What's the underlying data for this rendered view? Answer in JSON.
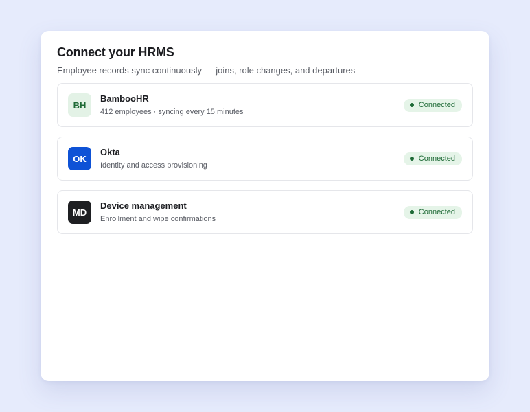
{
  "header": {
    "title": "Connect your HRMS",
    "subtitle": "Employee records sync continuously — joins, role changes, and departures"
  },
  "integrations": [
    {
      "initials": "BH",
      "name": "BambooHR",
      "description": "412 employees · syncing every 15 minutes",
      "status": "Connected",
      "badge_bg": "#e3f2e6",
      "badge_fg": "#1e6a36"
    },
    {
      "initials": "OK",
      "name": "Okta",
      "description": "Identity and access provisioning",
      "status": "Connected",
      "badge_bg": "#0e52d6",
      "badge_fg": "#ffffff"
    },
    {
      "initials": "MD",
      "name": "Device management",
      "description": "Enrollment and wipe confirmations",
      "status": "Connected",
      "badge_bg": "#1e1f22",
      "badge_fg": "#ffffff"
    }
  ],
  "colors": {
    "page_bg": "#e6ebfc",
    "status_bg": "#e5f4e8",
    "status_fg": "#1e6a36"
  }
}
